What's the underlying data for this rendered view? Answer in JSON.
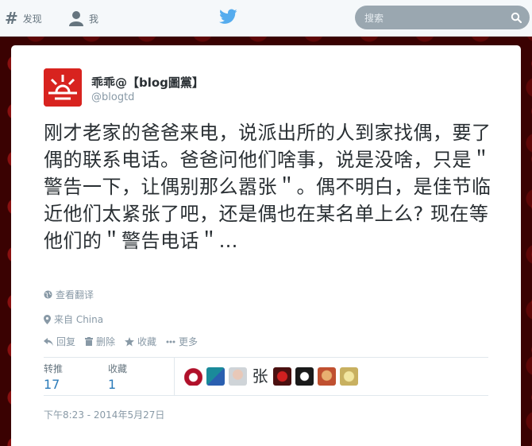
{
  "nav": {
    "discover_label": "发现",
    "me_label": "我",
    "search_placeholder": "搜索"
  },
  "tweet": {
    "display_name": "乖乖@【blog圖黨】",
    "screen_name": "@blogtd",
    "text": "刚才老家的爸爸来电，说派出所的人到家找偶，要了偶的联系电话。爸爸问他们啥事，说是没啥，只是＂警告一下，让偶别那么嚣张＂。偶不明白，是佳节临近他们太紧张了吧，还是偶也在某名单上么? 现在等他们的＂警告电话＂…",
    "translate_label": "查看翻译",
    "location_label": "来自 China",
    "actions": {
      "reply": "回复",
      "delete": "删除",
      "favorite": "收藏",
      "more": "更多"
    },
    "stats": {
      "retweets_label": "转推",
      "retweets_count": "17",
      "favorites_label": "收藏",
      "favorites_count": "1"
    },
    "favoriter_text_avatar": "张",
    "timestamp": "下午8:23 - 2014年5月27日"
  },
  "colors": {
    "accent": "#2b7bb9",
    "twitter_blue": "#55acee",
    "avatar_red": "#d8231f"
  }
}
